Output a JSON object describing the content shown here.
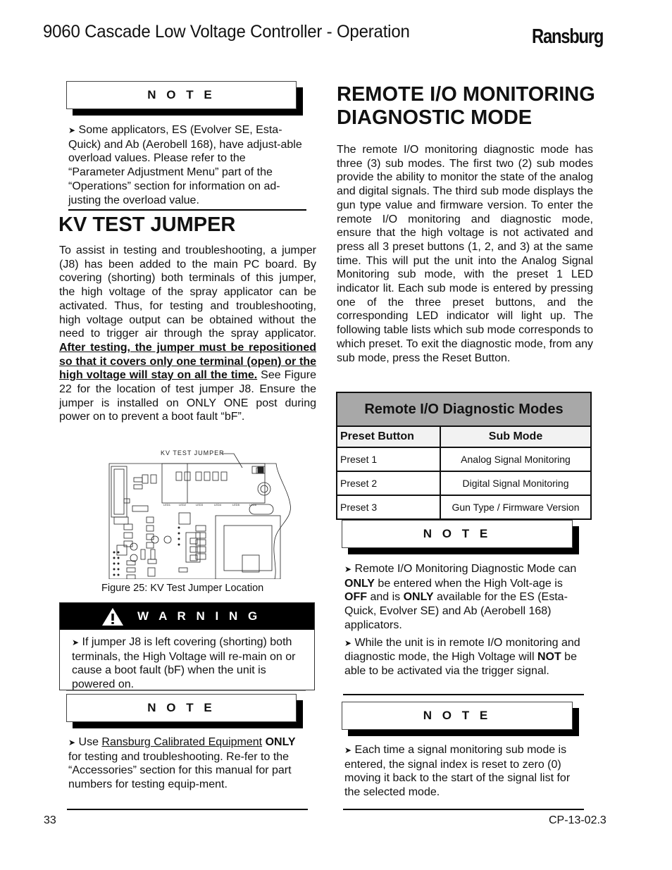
{
  "header": {
    "title": "9060 Cascade Low Voltage Controller - Operation",
    "brand": "Ransburg"
  },
  "left": {
    "note1": {
      "label": "N O T E",
      "text": "Some applicators, ES (Evolver SE, Esta-Quick) and Ab (Aerobell 168), have adjust-able overload values.  Please refer to the “Parameter Adjustment Menu” part of the “Operations” section for information on ad-justing the overload value."
    },
    "section_title": "KV TEST JUMPER",
    "body_part1": "To assist in testing and troubleshooting, a jumper (J8) has been added to the main PC board.  By covering (shorting) both terminals of this jumper, the high voltage of the spray applicator can be activated.  Thus, for testing and troubleshooting, high voltage output can be obtained without the need to trigger air through the spray applicator.  ",
    "body_emphasis": "After testing, the jumper must be repositioned so that it covers only one terminal (open) or the high voltage will stay on all the time.",
    "body_part2": "  See Figure 22 for the location of test jumper J8.  Ensure the jumper is installed on ONLY ONE post during power on to prevent a boot fault “bF”.",
    "figure": {
      "callout": "KV TEST JUMPER",
      "caption": "Figure 25: KV Test Jumper Location"
    },
    "warning": {
      "label": "W A R N I N G",
      "icon": "warning-triangle-icon",
      "text": "If jumper J8 is left covering (shorting) both terminals, the High Voltage will re-main on or cause a boot fault (bF) when the unit is powered on."
    },
    "note2": {
      "label": "N O T E",
      "text_prefix": "Use ",
      "link_text": "Ransburg Calibrated Equipment",
      "bold_text": "ONLY",
      "text_suffix": " for testing and troubleshooting.  Re-fer to the “Accessories” section for this manual for part numbers for testing equip-ment."
    }
  },
  "right": {
    "section_title_line1": "REMOTE I/O MONITORING",
    "section_title_line2": "DIAGNOSTIC MODE",
    "body": "The remote I/O monitoring diagnostic mode has three (3) sub modes.  The first two (2) sub modes provide the ability to monitor the state of the analog and digital signals.  The third sub mode displays the gun type value and firmware version.  To enter the remote I/O monitoring and diagnostic mode, ensure that the high voltage is not activated and press all 3 preset buttons (1, 2, and 3) at the same time.  This will put the unit into the Analog Signal Monitoring sub mode, with the preset 1 LED indicator lit.  Each sub mode is entered by pressing one of the three preset buttons, and the corresponding LED indicator will light up.  The following table lists which sub mode corresponds to which preset.  To exit the diagnostic mode, from any sub mode, press the Reset Button.",
    "table": {
      "title": "Remote I/O Diagnostic Modes",
      "headers": [
        "Preset Button",
        "Sub Mode"
      ],
      "rows": [
        [
          "Preset 1",
          "Analog Signal Monitoring"
        ],
        [
          "Preset 2",
          "Digital Signal Monitoring"
        ],
        [
          "Preset 3",
          "Gun Type / Firmware Version"
        ]
      ]
    },
    "note1": {
      "label": "N O T E",
      "b1_a": "Remote I/O Monitoring Diagnostic Mode can ",
      "b1_b": "ONLY",
      "b1_c": " be entered when the High Volt-age is ",
      "b1_d": "OFF",
      "b1_e": " and is ",
      "b1_f": "ONLY",
      "b1_g": " available for the ES (Esta-Quick, Evolver SE) and Ab (Aerobell 168) applicators.",
      "b2_a": "While the unit is in remote I/O monitoring and diagnostic mode, the High Voltage will ",
      "b2_b": "NOT",
      "b2_c": " be able to be activated via the trigger signal."
    },
    "note2": {
      "label": "N O T E",
      "text": "Each time a signal monitoring sub mode is entered, the signal index is reset to zero (0) moving it back to the start of the signal list for the selected mode."
    }
  },
  "footer": {
    "page_number": "33",
    "doc_code": "CP-13-02.3"
  },
  "bullet_glyph": "➤"
}
